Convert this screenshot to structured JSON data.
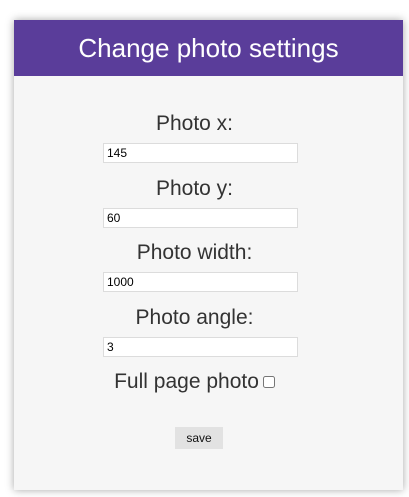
{
  "dialog": {
    "title": "Change photo settings"
  },
  "fields": {
    "photo_x": {
      "label": "Photo x:",
      "value": "145"
    },
    "photo_y": {
      "label": "Photo y:",
      "value": "60"
    },
    "photo_width": {
      "label": "Photo width:",
      "value": "1000"
    },
    "photo_angle": {
      "label": "Photo angle:",
      "value": "3"
    }
  },
  "full_page": {
    "label": "Full page photo",
    "checked": false
  },
  "actions": {
    "save_label": "save"
  },
  "colors": {
    "header_bg": "#5a3d9a",
    "panel_bg": "#f6f6f6",
    "button_bg": "#e2e2e2"
  }
}
